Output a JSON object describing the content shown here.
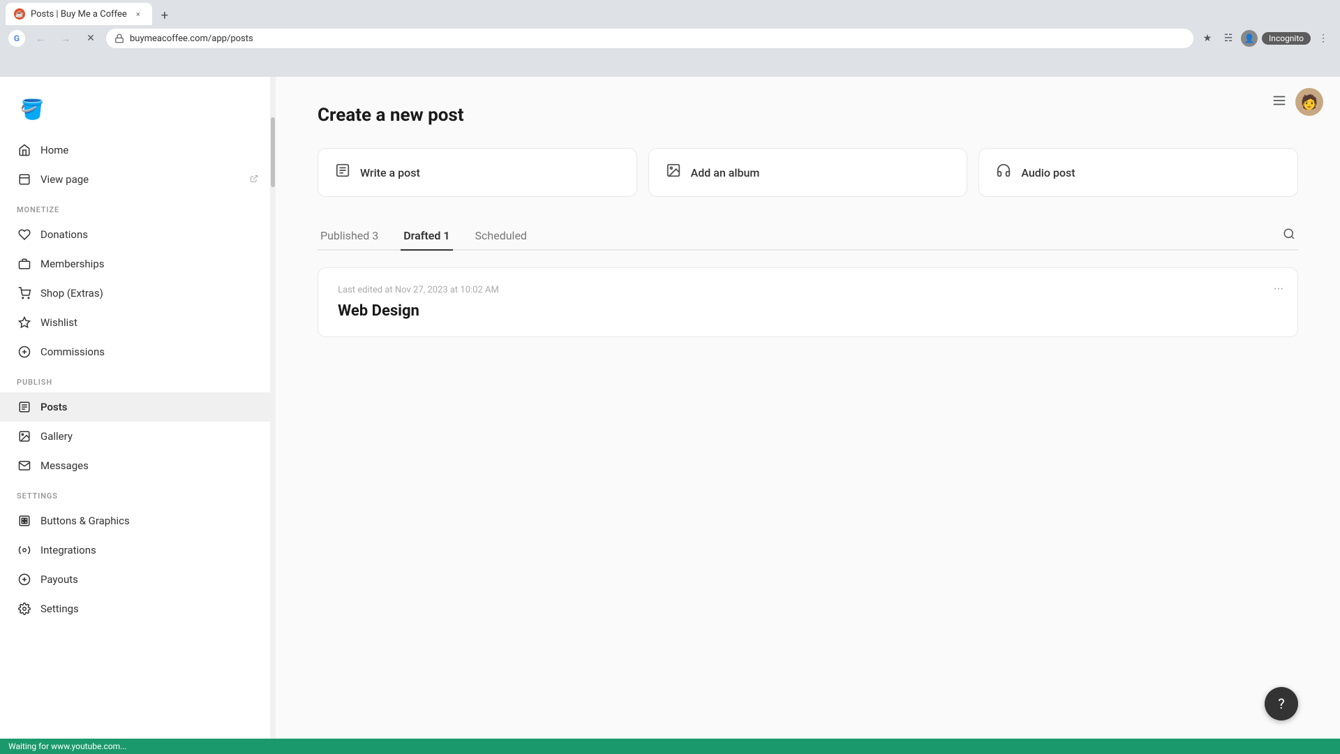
{
  "browser": {
    "tab_title": "Posts | Buy Me a Coffee",
    "tab_favicon": "☕",
    "close_tab": "×",
    "new_tab": "+",
    "address": "buymeacoffee.com/app/posts",
    "incognito_label": "Incognito",
    "nav_back": "←",
    "nav_forward": "→",
    "nav_reload": "✕",
    "nav_home": "⌂"
  },
  "sidebar": {
    "logo": "🪣",
    "nav_main": [
      {
        "id": "home",
        "label": "Home",
        "icon": "⌂",
        "type": "home"
      },
      {
        "id": "view-page",
        "label": "View page",
        "icon": "⊞",
        "type": "external"
      }
    ],
    "monetize_label": "MONETIZE",
    "nav_monetize": [
      {
        "id": "donations",
        "label": "Donations",
        "icon": "♡"
      },
      {
        "id": "memberships",
        "label": "Memberships",
        "icon": "⊞"
      },
      {
        "id": "shop",
        "label": "Shop (Extras)",
        "icon": "⊞"
      },
      {
        "id": "wishlist",
        "label": "Wishlist",
        "icon": "⊞"
      },
      {
        "id": "commissions",
        "label": "Commissions",
        "icon": "◎"
      }
    ],
    "publish_label": "PUBLISH",
    "nav_publish": [
      {
        "id": "posts",
        "label": "Posts",
        "icon": "▦",
        "active": true
      },
      {
        "id": "gallery",
        "label": "Gallery",
        "icon": "⊞"
      },
      {
        "id": "messages",
        "label": "Messages",
        "icon": "✉"
      }
    ],
    "settings_label": "SETTINGS",
    "nav_settings": [
      {
        "id": "buttons-graphics",
        "label": "Buttons & Graphics",
        "icon": "⊞"
      },
      {
        "id": "integrations",
        "label": "Integrations",
        "icon": "✦"
      },
      {
        "id": "payouts",
        "label": "Payouts",
        "icon": "◎"
      },
      {
        "id": "settings",
        "label": "Settings",
        "icon": "⊞"
      }
    ]
  },
  "main": {
    "title": "Create a new post",
    "post_types": [
      {
        "id": "write-post",
        "label": "Write a post",
        "icon": "📄"
      },
      {
        "id": "add-album",
        "label": "Add an album",
        "icon": "🖼"
      },
      {
        "id": "audio-post",
        "label": "Audio post",
        "icon": "🎧"
      }
    ],
    "tabs": [
      {
        "id": "published",
        "label": "Published 3",
        "active": false
      },
      {
        "id": "drafted",
        "label": "Drafted 1",
        "active": true
      },
      {
        "id": "scheduled",
        "label": "Scheduled",
        "active": false
      }
    ],
    "post_card": {
      "meta": "Last edited at Nov 27, 2023 at 10:02 AM",
      "title": "Web Design",
      "menu_icon": "···"
    }
  },
  "footer": {
    "status_text": "Waiting for www.youtube.com..."
  },
  "help_button": "?"
}
